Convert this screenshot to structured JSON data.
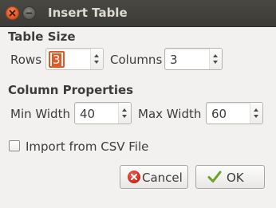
{
  "window": {
    "title": "Insert Table"
  },
  "table_size": {
    "heading": "Table Size",
    "rows_label": "Rows",
    "rows_value": "3",
    "columns_label": "Columns",
    "columns_value": "3"
  },
  "column_properties": {
    "heading": "Column Properties",
    "min_width_label": "Min Width",
    "min_width_value": "40",
    "max_width_label": "Max Width",
    "max_width_value": "60"
  },
  "import": {
    "label": "Import from CSV File",
    "checked": false
  },
  "buttons": {
    "cancel_label": "Cancel",
    "ok_label": "OK"
  },
  "icons": {
    "close": "close-icon",
    "minimize": "minimize-icon",
    "cancel": "cancel-icon",
    "ok": "checkmark-icon"
  },
  "colors": {
    "titlebar": "#3c3b37",
    "close_button": "#e15a25",
    "focus_accent": "#e05a28",
    "cancel_icon": "#d4251a",
    "ok_check": "#6aa520"
  }
}
